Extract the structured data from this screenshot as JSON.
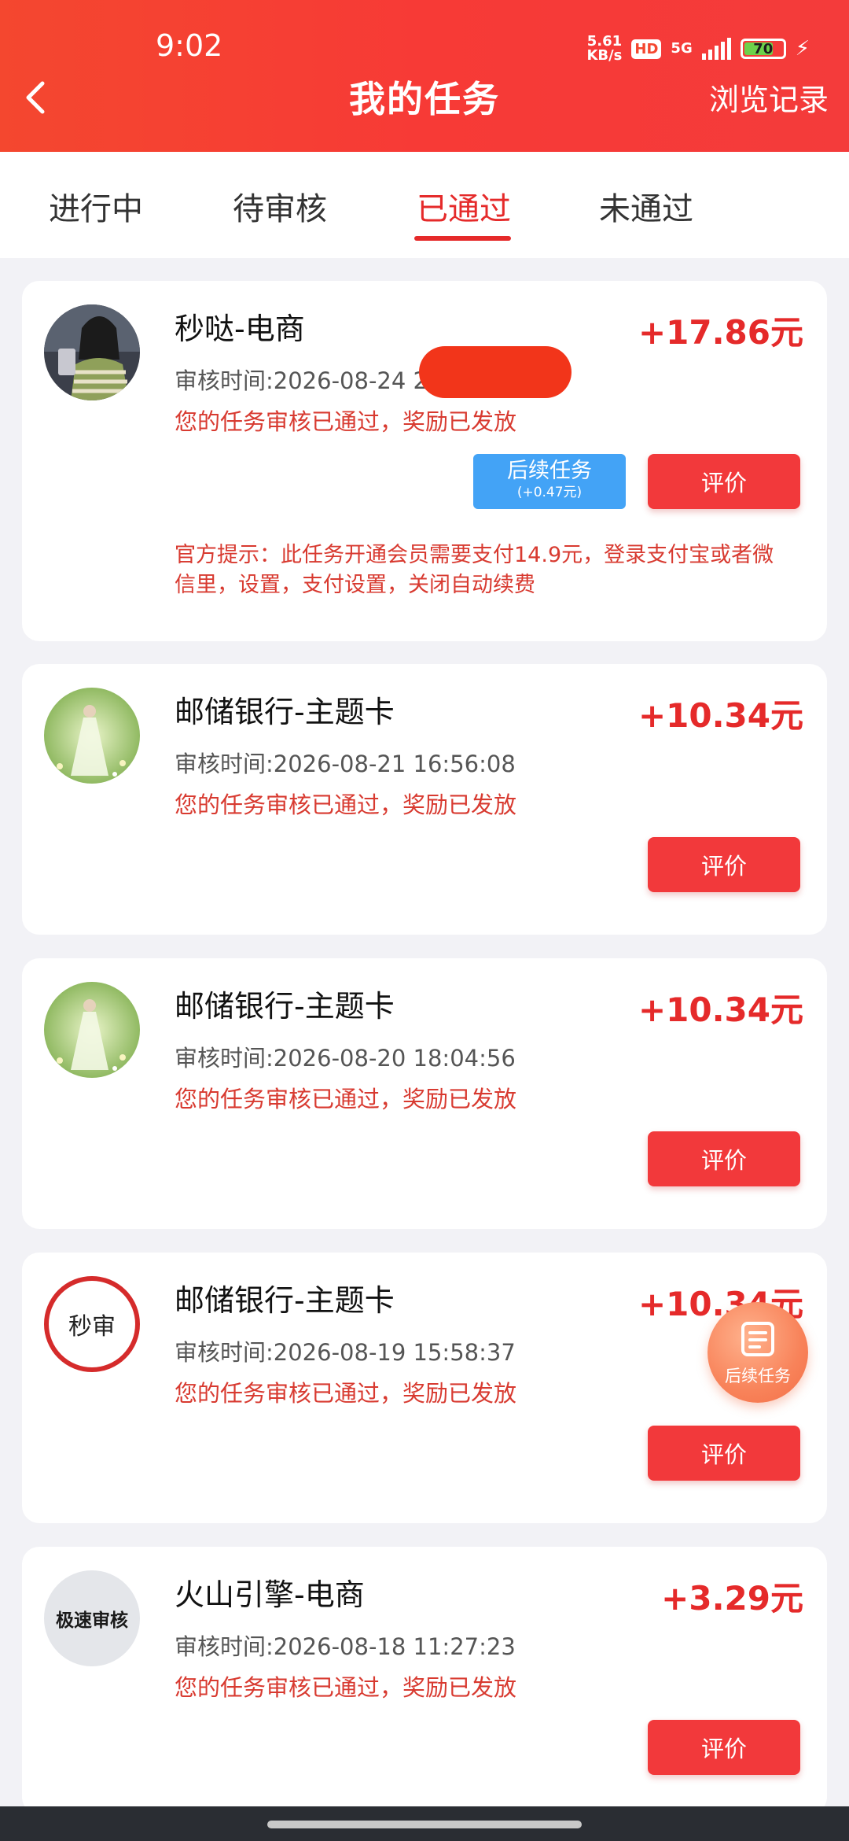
{
  "status_bar": {
    "time": "9:02",
    "net_speed_value": "5.61",
    "net_speed_unit": "KB/s",
    "hd": "HD",
    "network": "5G",
    "battery": "70"
  },
  "header": {
    "title": "我的任务",
    "history_label": "浏览记录"
  },
  "tabs": [
    {
      "label": "进行中"
    },
    {
      "label": "待审核"
    },
    {
      "label": "已通过"
    },
    {
      "label": "未通过"
    }
  ],
  "active_tab": "已通过",
  "tasks": [
    {
      "title": "秒哒-电商",
      "amount": "+17.86元",
      "time": "审核时间:2026-08-24 2",
      "status": "您的任务审核已通过，奖励已发放",
      "follow_label": "后续任务",
      "follow_bonus": "(+0.47元)",
      "eval_label": "评价",
      "hint": "官方提示：此任务开通会员需要支付14.9元，登录支付宝或者微信里，设置，支付设置，关闭自动续费"
    },
    {
      "title": "邮储银行-主题卡",
      "amount": "+10.34元",
      "time": "审核时间:2026-08-21 16:56:08",
      "status": "您的任务审核已通过，奖励已发放",
      "eval_label": "评价"
    },
    {
      "title": "邮储银行-主题卡",
      "amount": "+10.34元",
      "time": "审核时间:2026-08-20 18:04:56",
      "status": "您的任务审核已通过，奖励已发放",
      "eval_label": "评价"
    },
    {
      "title": "邮储银行-主题卡",
      "amount": "+10.34元",
      "time": "审核时间:2026-08-19 15:58:37",
      "status": "您的任务审核已通过，奖励已发放",
      "eval_label": "评价",
      "avatar_text": "秒审"
    },
    {
      "title": "火山引擎-电商",
      "amount": "+3.29元",
      "time": "审核时间:2026-08-18 11:27:23",
      "status": "您的任务审核已通过，奖励已发放",
      "eval_label": "评价",
      "avatar_text": "极速审核"
    }
  ],
  "float_button": {
    "label": "后续任务"
  },
  "colors": {
    "header_red": "#f4472f",
    "accent_red": "#e52a2a",
    "follow_blue": "#43a3f6",
    "float_orange": "#f8835a"
  }
}
